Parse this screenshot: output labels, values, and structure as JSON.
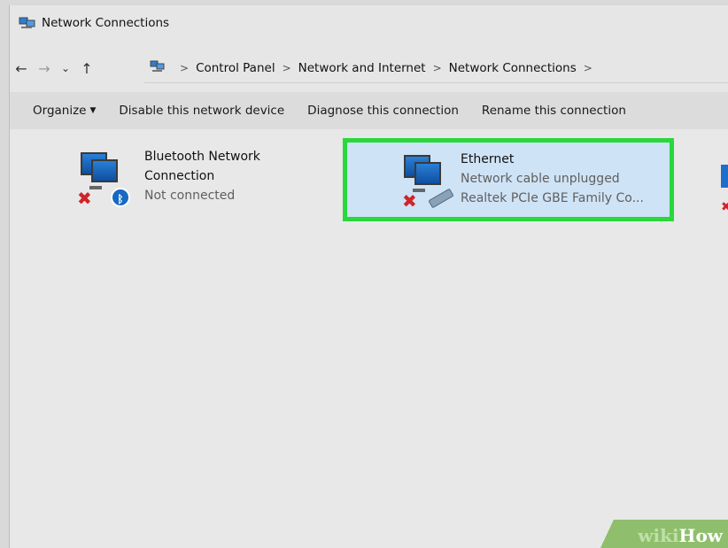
{
  "window": {
    "title": "Network Connections",
    "title_icon": "network-connections-icon"
  },
  "nav": {
    "back": "←",
    "forward": "→",
    "recent": "⌄",
    "up": "↑"
  },
  "breadcrumb": [
    "Control Panel",
    "Network and Internet",
    "Network Connections"
  ],
  "breadcrumb_sep": ">",
  "toolbar": {
    "organize": "Organize",
    "disable": "Disable this network device",
    "diagnose": "Diagnose this connection",
    "rename": "Rename this connection"
  },
  "connections": [
    {
      "name": "Bluetooth Network",
      "name2": "Connection",
      "status": "Not connected",
      "device": ""
    },
    {
      "name": "Ethernet",
      "status": "Network cable unplugged",
      "device": "Realtek PCIe GBE Family Co..."
    }
  ],
  "colors": {
    "highlight_border": "#29d83a",
    "selection_bg": "#cfe3f6",
    "error": "#d2232a"
  },
  "watermark": {
    "wiki": "wiki",
    "how": "How"
  }
}
